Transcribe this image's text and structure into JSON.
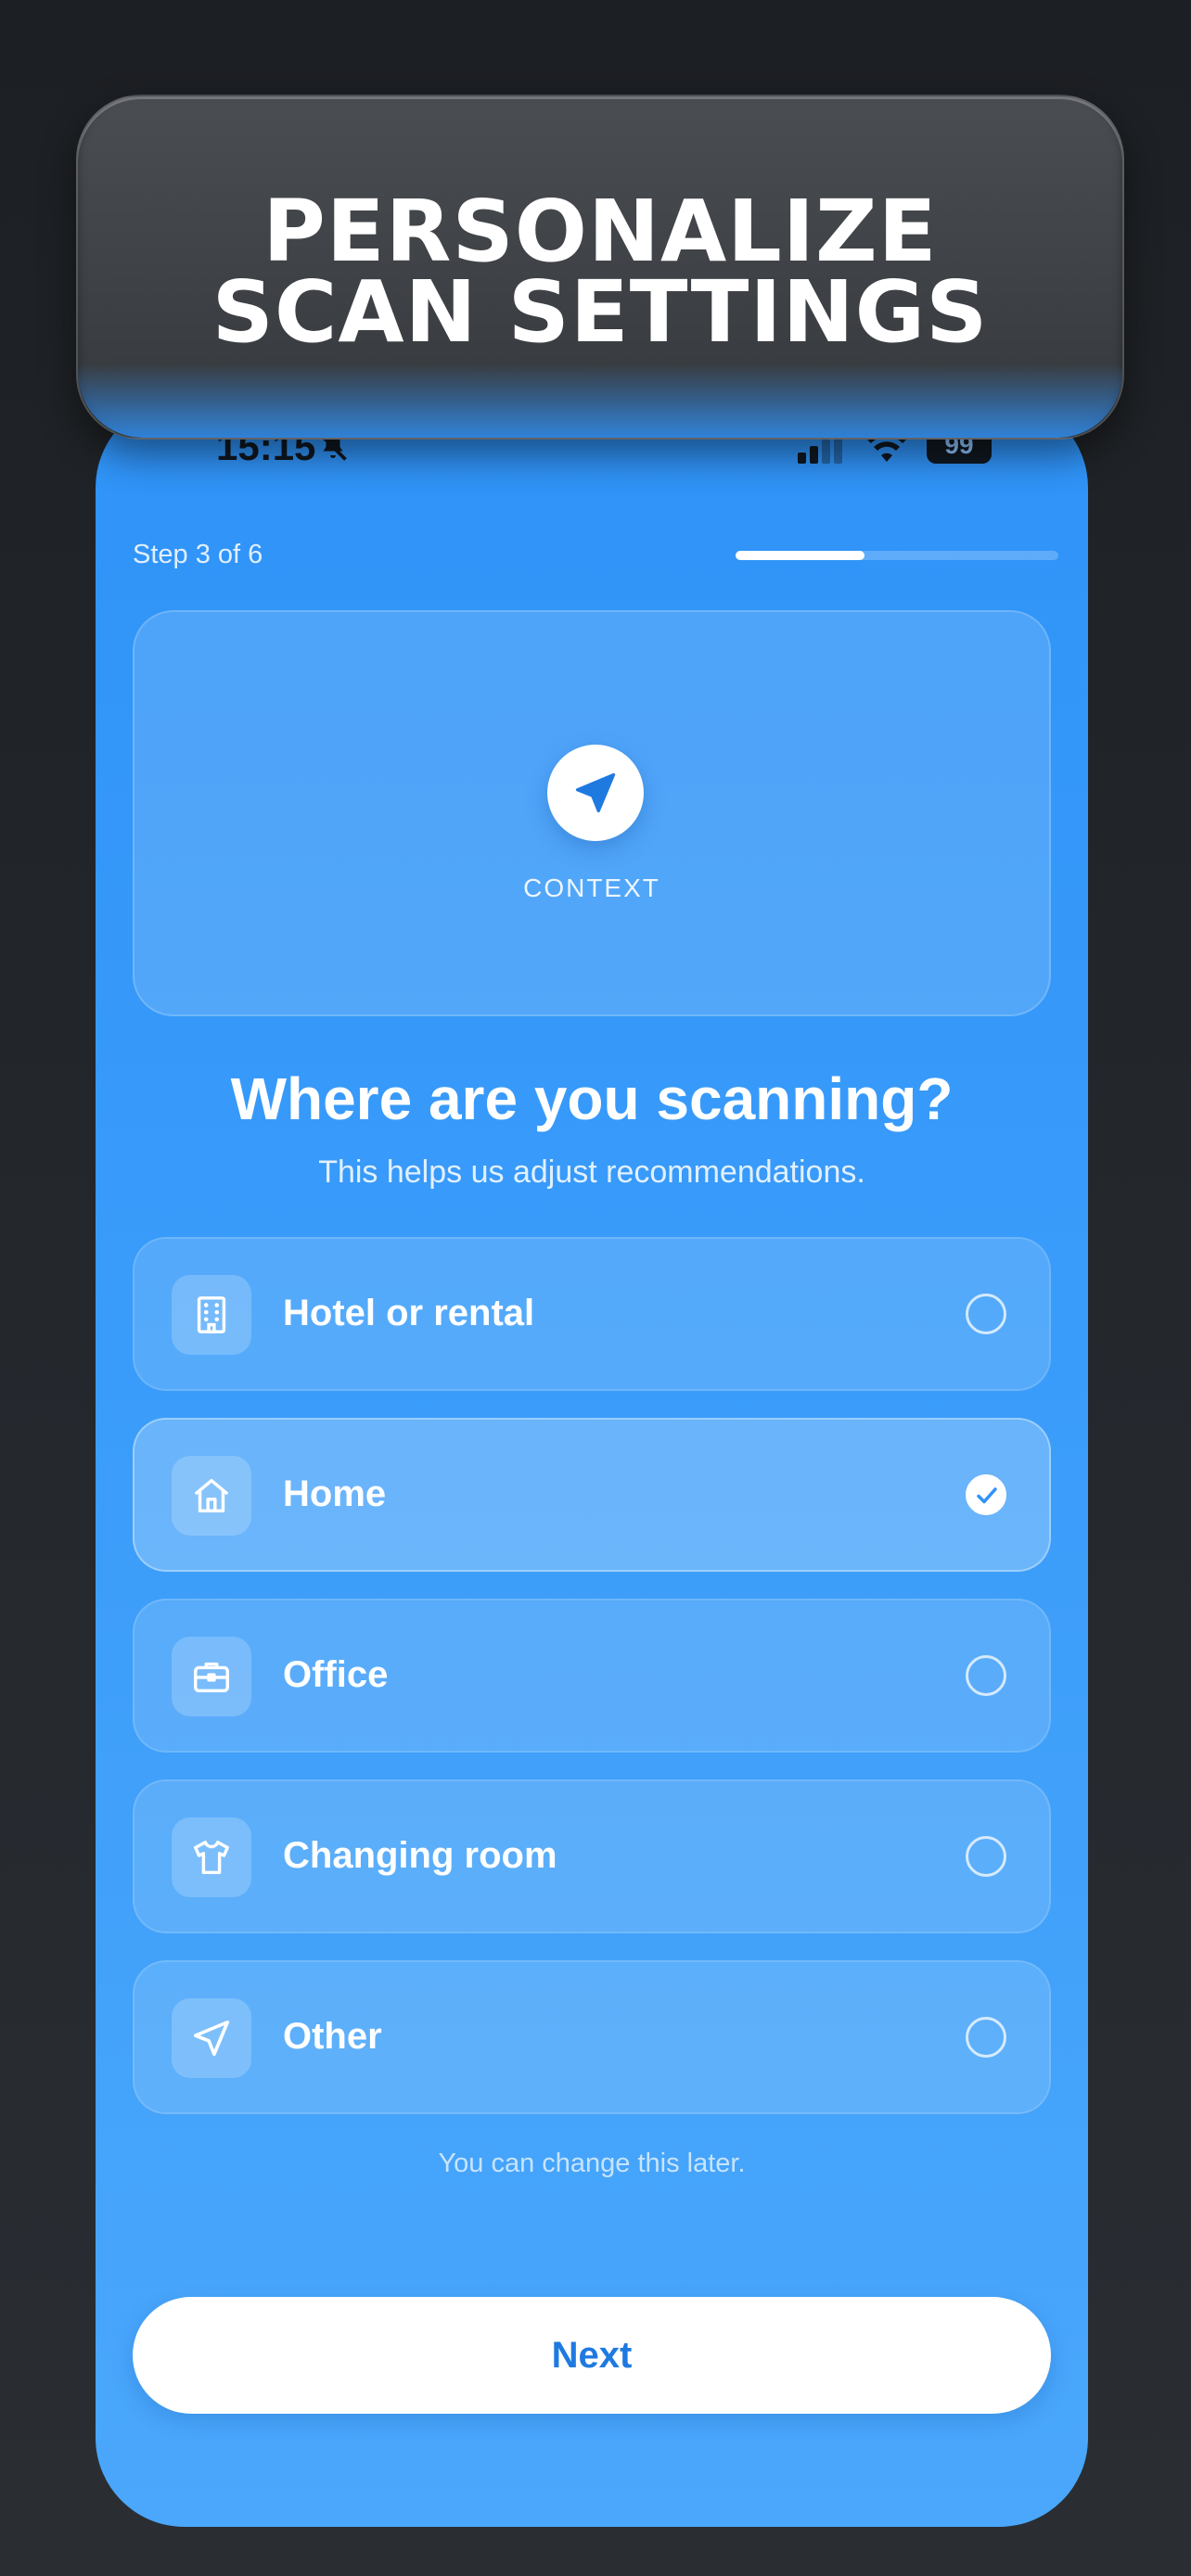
{
  "banner": {
    "line1": "PERSONALIZE",
    "line2": "SCAN SETTINGS"
  },
  "status_bar": {
    "time": "15:15",
    "battery": "99"
  },
  "step": {
    "label": "Step 3 of 6",
    "progress": 0.4
  },
  "hero": {
    "icon": "location-arrow-icon",
    "caption": "CONTEXT"
  },
  "question": {
    "title": "Where are you scanning?",
    "subtitle": "This helps us adjust recommendations."
  },
  "options": [
    {
      "label": "Hotel or rental",
      "icon": "building-icon",
      "selected": false
    },
    {
      "label": "Home",
      "icon": "home-icon",
      "selected": true
    },
    {
      "label": "Office",
      "icon": "briefcase-icon",
      "selected": false
    },
    {
      "label": "Changing room",
      "icon": "shirt-icon",
      "selected": false
    },
    {
      "label": "Other",
      "icon": "location-arrow-icon",
      "selected": false
    }
  ],
  "footnote": "You can change this later.",
  "next_button": {
    "label": "Next"
  },
  "colors": {
    "accent": "#1f7ae0",
    "background": "#3a9cfa"
  }
}
